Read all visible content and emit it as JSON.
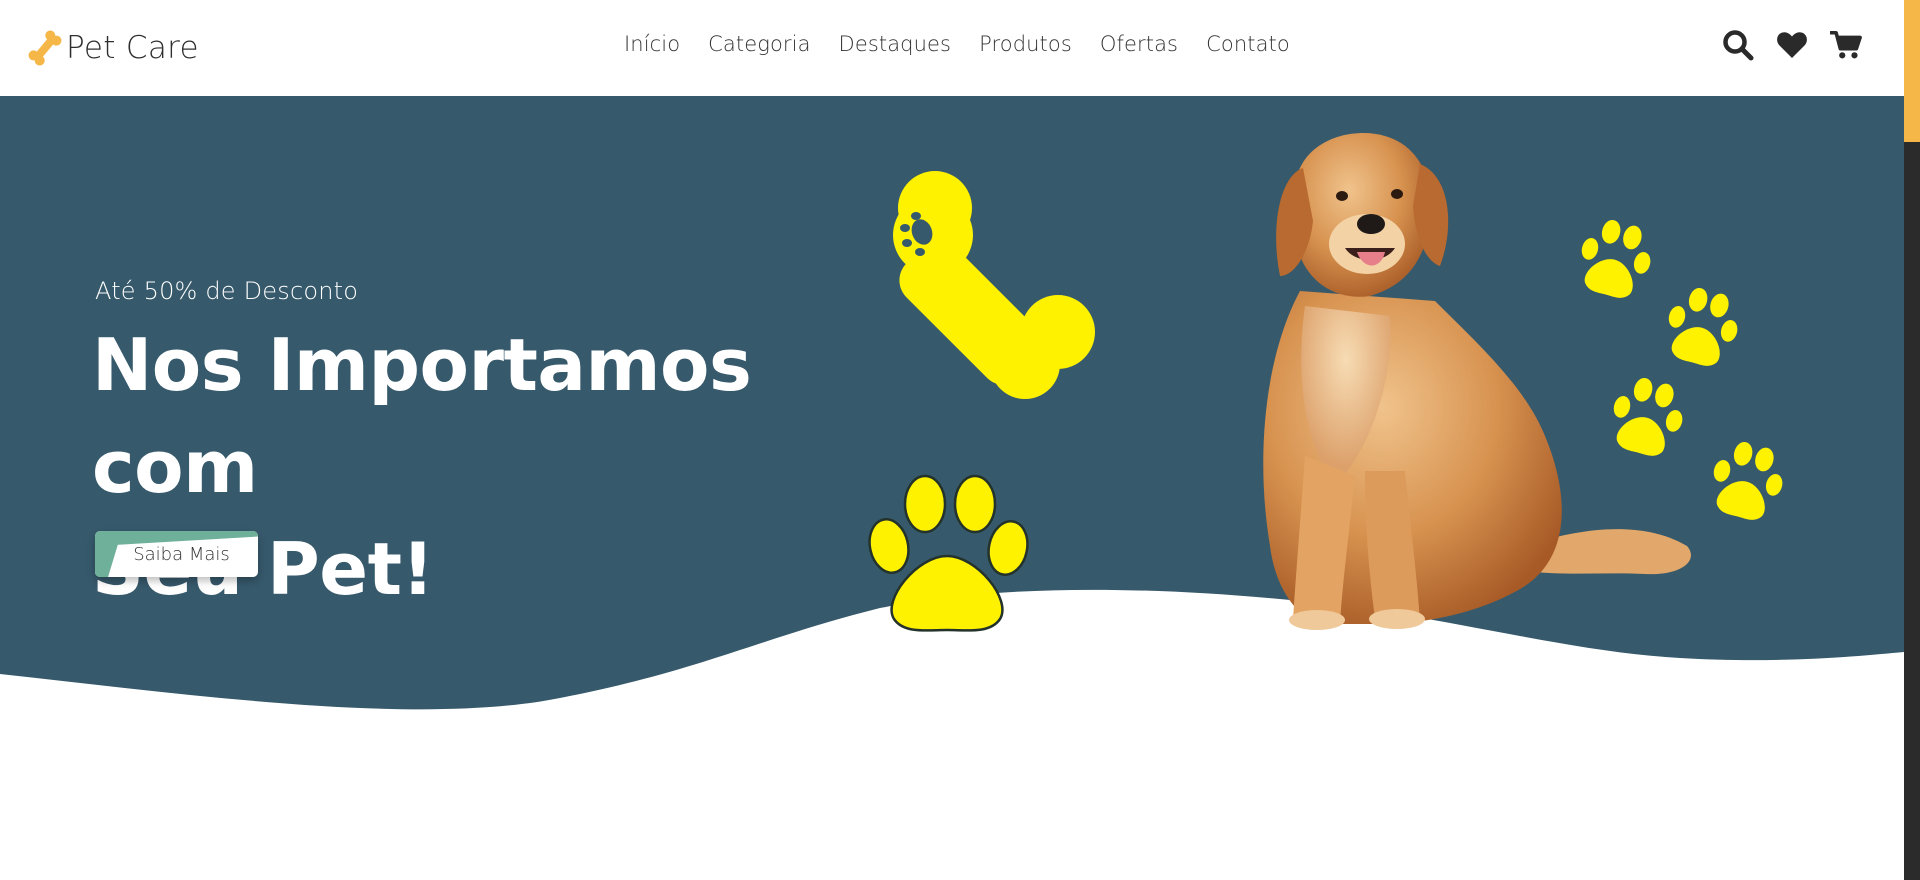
{
  "brand": {
    "name": "Pet Care",
    "logo_icon": "bone-icon",
    "accent": "#f5b748"
  },
  "nav": {
    "items": [
      {
        "label": "Início"
      },
      {
        "label": "Categoria"
      },
      {
        "label": "Destaques"
      },
      {
        "label": "Produtos"
      },
      {
        "label": "Ofertas"
      },
      {
        "label": "Contato"
      }
    ]
  },
  "header_icons": [
    "search-icon",
    "heart-icon",
    "cart-icon"
  ],
  "hero": {
    "subtitle": "Até 50% de Desconto",
    "title_line1": "Nos Importamos com",
    "title_line2": "Seu Pet!",
    "cta_label": "Saiba Mais",
    "background": "#36596b",
    "decor_color": "#fff200",
    "cta_accent": "#6fb09a"
  }
}
